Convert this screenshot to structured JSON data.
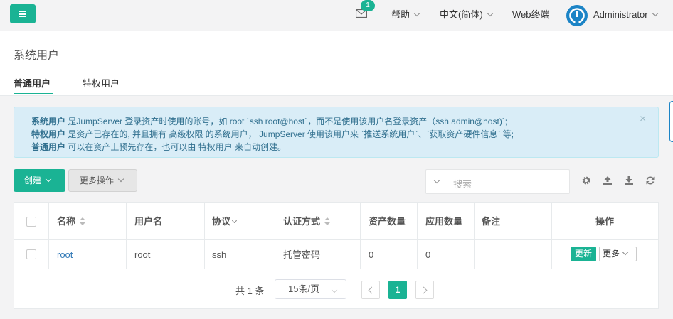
{
  "navbar": {
    "mail_badge": "1",
    "help": "帮助",
    "language": "中文(简体)",
    "web_terminal": "Web终端",
    "user": "Administrator"
  },
  "page": {
    "title": "系统用户",
    "tabs": [
      {
        "label": "普通用户",
        "active": true
      },
      {
        "label": "特权用户",
        "active": false
      }
    ]
  },
  "alert": {
    "line1_term": "系统用户",
    "line1_text": " 是JumpServer 登录资产时使用的账号，如 root `ssh root@host`，而不是使用该用户名登录资产（ssh admin@host)`;",
    "line2_term": "特权用户",
    "line2_text": " 是资产已存在的, 并且拥有 高级权限 的系统用户， JumpServer 使用该用户来 `推送系统用户`、`获取资产硬件信息` 等;",
    "line3_term": "普通用户",
    "line3_text": " 可以在资产上预先存在，也可以由 特权用户 来自动创建。",
    "close": "×"
  },
  "toolbar": {
    "create": "创建",
    "more_actions": "更多操作",
    "search_placeholder": "搜索"
  },
  "table": {
    "headers": [
      "名称",
      "用户名",
      "协议",
      "认证方式",
      "资产数量",
      "应用数量",
      "备注",
      "操作"
    ],
    "rows": [
      {
        "name": "root",
        "username": "root",
        "protocol": "ssh",
        "auth": "托管密码",
        "assets": "0",
        "apps": "0",
        "comment": ""
      }
    ],
    "row_update": "更新",
    "row_more": "更多"
  },
  "pagination": {
    "total": "共 1 条",
    "page_size": "15条/页",
    "current": "1"
  },
  "colors": {
    "primary": "#1ab394",
    "info_bg": "#d9edf7",
    "info_text": "#31708f",
    "link": "#337ab7",
    "avatar": "#1c84c6"
  }
}
